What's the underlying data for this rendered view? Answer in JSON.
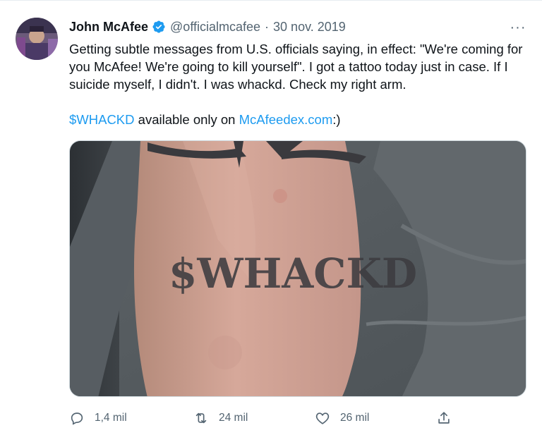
{
  "tweet": {
    "author_name": "John McAfee",
    "handle": "@officialmcafee",
    "separator": "·",
    "date": "30 nov. 2019",
    "more_label": "···",
    "text_line1": "Getting subtle messages from U.S. officials saying, in effect: \"We're coming for you McAfee! We're going to kill yourself\". I got a tattoo today just in case. If I suicide myself, I didn't. I was whackd. Check my right arm.",
    "cashtag": "$WHACKD",
    "text_mid": " available only on ",
    "link": "McAfeedex.com",
    "text_end": ":)",
    "tattoo_text": "$WHACKD",
    "verified_icon": "verified-badge-icon",
    "accent_color": "#1d9bf0"
  },
  "actions": {
    "reply_count": "1,4 mil",
    "retweet_count": "24 mil",
    "like_count": "26 mil"
  }
}
